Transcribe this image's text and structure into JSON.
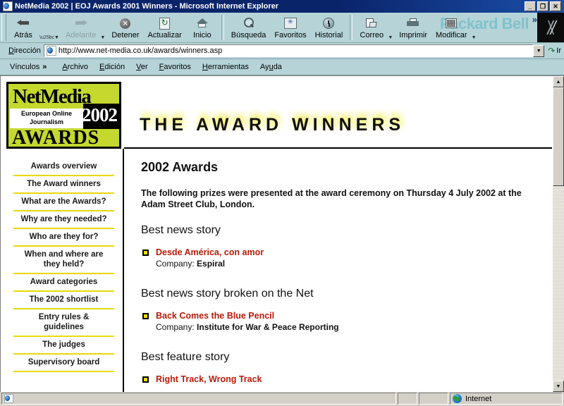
{
  "window": {
    "title": "NetMedia 2002 | EOJ Awards 2001 Winners - Microsoft Internet Explorer",
    "minimize_label": "_",
    "restore_label": "❐",
    "close_label": "✕"
  },
  "toolbar": {
    "buttons": [
      {
        "label": "Atrás",
        "icon": "back-arrow-icon",
        "disabled": false,
        "has_dropdown": true
      },
      {
        "label": "Adelante",
        "icon": "forward-arrow-icon",
        "disabled": true,
        "has_dropdown": true
      },
      {
        "label": "Detener",
        "icon": "stop-icon",
        "disabled": false,
        "has_dropdown": false
      },
      {
        "label": "Actualizar",
        "icon": "refresh-icon",
        "disabled": false,
        "has_dropdown": false
      },
      {
        "label": "Inicio",
        "icon": "home-icon",
        "disabled": false,
        "has_dropdown": false
      },
      {
        "label": "Búsqueda",
        "icon": "search-icon",
        "disabled": false,
        "has_dropdown": false
      },
      {
        "label": "Favoritos",
        "icon": "favorites-icon",
        "disabled": false,
        "has_dropdown": false
      },
      {
        "label": "Historial",
        "icon": "history-icon",
        "disabled": false,
        "has_dropdown": false
      },
      {
        "label": "Correo",
        "icon": "mail-icon",
        "disabled": false,
        "has_dropdown": true
      },
      {
        "label": "Imprimir",
        "icon": "print-icon",
        "disabled": false,
        "has_dropdown": false
      },
      {
        "label": "Modificar",
        "icon": "edit-icon",
        "disabled": false,
        "has_dropdown": true
      }
    ],
    "branding": "Packard Bell",
    "overflow_chevron": "»"
  },
  "address_bar": {
    "label": "Dirección",
    "label_accel": "D",
    "url": "http://www.net-media.co.uk/awards/winners.asp",
    "dropdown_icon": "▼",
    "go_label": "Ir",
    "go_icon": "go-arrow-icon"
  },
  "links_bar": {
    "links_label": "Vínculos",
    "chevron": "»",
    "menu": [
      {
        "label": "Archivo",
        "accel": "A"
      },
      {
        "label": "Edición",
        "accel": "E"
      },
      {
        "label": "Ver",
        "accel": "V"
      },
      {
        "label": "Favoritos",
        "accel": "F"
      },
      {
        "label": "Herramientas",
        "accel": "H"
      },
      {
        "label": "Ayuda",
        "accel": "u"
      }
    ]
  },
  "page": {
    "logo": {
      "netmedia": "NetMedia",
      "subtitle_line1": "European Online",
      "subtitle_line2": "Journalism",
      "year": "2002",
      "awards": "AWARDS",
      "bg_color": "#c4d82e"
    },
    "banner_title": "THE AWARD WINNERS",
    "banner_glow_color": "#f3e800",
    "nav_items": [
      "Awards overview",
      "The Award winners",
      "What are the Awards?",
      "Why are they needed?",
      "Who are they for?",
      "When and where are they held?",
      "Award categories",
      "The 2002 shortlist",
      "Entry rules & guidelines",
      "The judges",
      "Supervisory board"
    ],
    "nav_divider_color": "#e8d90a",
    "heading": "2002 Awards",
    "intro": "The following prizes were presented at the award ceremony on Thursday 4 July 2002 at the Adam Street Club, London.",
    "company_label": "Company:",
    "link_color": "#b91a08",
    "bullet_color": "#f2e000",
    "categories": [
      {
        "title": "Best news story",
        "winner_title": "Desde América, con amor",
        "company": "Espiral"
      },
      {
        "title": "Best news story broken on the Net",
        "winner_title": "Back Comes the Blue Pencil",
        "company": "Institute for War & Peace Reporting"
      },
      {
        "title": "Best feature story",
        "winner_title": "Right Track, Wrong Track",
        "company": ""
      }
    ]
  },
  "scrollbar": {
    "up_arrow": "▲",
    "down_arrow": "▼"
  },
  "status_bar": {
    "message": "",
    "zone_label": "Internet",
    "zone_icon": "globe-icon"
  }
}
